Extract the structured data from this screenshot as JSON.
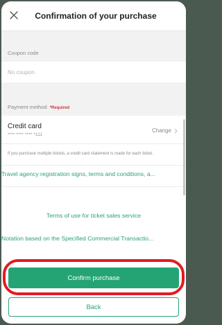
{
  "header": {
    "title": "Confirmation of your purchase",
    "close_icon": "close-icon"
  },
  "coupon": {
    "label": "Coupon code",
    "value": "No coupon."
  },
  "payment": {
    "label": "Payment method",
    "required": "*Required",
    "method": "Credit card",
    "card_number": "**** **** **** *111",
    "change_label": "Change",
    "note": "If you purchase multiple tickets, a credit card statement is made for each ticket."
  },
  "links": {
    "travel_agency": "Travel agency registration signs, terms and conditions, a...",
    "terms_of_use": "Terms of use for ticket sales service",
    "specified_commercial": "Notation based on the Specified Commercial Transactio..."
  },
  "actions": {
    "confirm_label": "Confirm purchase",
    "back_label": "Back"
  },
  "colors": {
    "accent": "#24a475",
    "required": "#d0333b",
    "highlight_ring": "#e11b22"
  }
}
